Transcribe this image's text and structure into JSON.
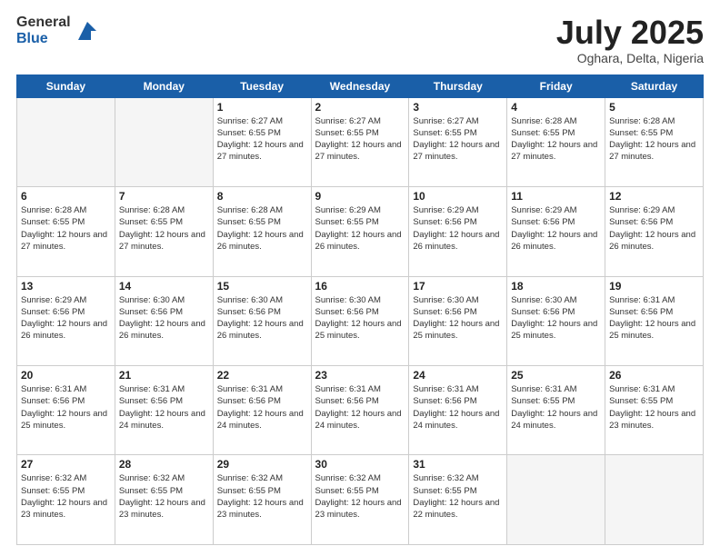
{
  "header": {
    "logo_general": "General",
    "logo_blue": "Blue",
    "month_title": "July 2025",
    "location": "Oghara, Delta, Nigeria"
  },
  "days_of_week": [
    "Sunday",
    "Monday",
    "Tuesday",
    "Wednesday",
    "Thursday",
    "Friday",
    "Saturday"
  ],
  "weeks": [
    [
      {
        "day": "",
        "info": ""
      },
      {
        "day": "",
        "info": ""
      },
      {
        "day": "1",
        "info": "Sunrise: 6:27 AM\nSunset: 6:55 PM\nDaylight: 12 hours and 27 minutes."
      },
      {
        "day": "2",
        "info": "Sunrise: 6:27 AM\nSunset: 6:55 PM\nDaylight: 12 hours and 27 minutes."
      },
      {
        "day": "3",
        "info": "Sunrise: 6:27 AM\nSunset: 6:55 PM\nDaylight: 12 hours and 27 minutes."
      },
      {
        "day": "4",
        "info": "Sunrise: 6:28 AM\nSunset: 6:55 PM\nDaylight: 12 hours and 27 minutes."
      },
      {
        "day": "5",
        "info": "Sunrise: 6:28 AM\nSunset: 6:55 PM\nDaylight: 12 hours and 27 minutes."
      }
    ],
    [
      {
        "day": "6",
        "info": "Sunrise: 6:28 AM\nSunset: 6:55 PM\nDaylight: 12 hours and 27 minutes."
      },
      {
        "day": "7",
        "info": "Sunrise: 6:28 AM\nSunset: 6:55 PM\nDaylight: 12 hours and 27 minutes."
      },
      {
        "day": "8",
        "info": "Sunrise: 6:28 AM\nSunset: 6:55 PM\nDaylight: 12 hours and 26 minutes."
      },
      {
        "day": "9",
        "info": "Sunrise: 6:29 AM\nSunset: 6:55 PM\nDaylight: 12 hours and 26 minutes."
      },
      {
        "day": "10",
        "info": "Sunrise: 6:29 AM\nSunset: 6:56 PM\nDaylight: 12 hours and 26 minutes."
      },
      {
        "day": "11",
        "info": "Sunrise: 6:29 AM\nSunset: 6:56 PM\nDaylight: 12 hours and 26 minutes."
      },
      {
        "day": "12",
        "info": "Sunrise: 6:29 AM\nSunset: 6:56 PM\nDaylight: 12 hours and 26 minutes."
      }
    ],
    [
      {
        "day": "13",
        "info": "Sunrise: 6:29 AM\nSunset: 6:56 PM\nDaylight: 12 hours and 26 minutes."
      },
      {
        "day": "14",
        "info": "Sunrise: 6:30 AM\nSunset: 6:56 PM\nDaylight: 12 hours and 26 minutes."
      },
      {
        "day": "15",
        "info": "Sunrise: 6:30 AM\nSunset: 6:56 PM\nDaylight: 12 hours and 26 minutes."
      },
      {
        "day": "16",
        "info": "Sunrise: 6:30 AM\nSunset: 6:56 PM\nDaylight: 12 hours and 25 minutes."
      },
      {
        "day": "17",
        "info": "Sunrise: 6:30 AM\nSunset: 6:56 PM\nDaylight: 12 hours and 25 minutes."
      },
      {
        "day": "18",
        "info": "Sunrise: 6:30 AM\nSunset: 6:56 PM\nDaylight: 12 hours and 25 minutes."
      },
      {
        "day": "19",
        "info": "Sunrise: 6:31 AM\nSunset: 6:56 PM\nDaylight: 12 hours and 25 minutes."
      }
    ],
    [
      {
        "day": "20",
        "info": "Sunrise: 6:31 AM\nSunset: 6:56 PM\nDaylight: 12 hours and 25 minutes."
      },
      {
        "day": "21",
        "info": "Sunrise: 6:31 AM\nSunset: 6:56 PM\nDaylight: 12 hours and 24 minutes."
      },
      {
        "day": "22",
        "info": "Sunrise: 6:31 AM\nSunset: 6:56 PM\nDaylight: 12 hours and 24 minutes."
      },
      {
        "day": "23",
        "info": "Sunrise: 6:31 AM\nSunset: 6:56 PM\nDaylight: 12 hours and 24 minutes."
      },
      {
        "day": "24",
        "info": "Sunrise: 6:31 AM\nSunset: 6:56 PM\nDaylight: 12 hours and 24 minutes."
      },
      {
        "day": "25",
        "info": "Sunrise: 6:31 AM\nSunset: 6:55 PM\nDaylight: 12 hours and 24 minutes."
      },
      {
        "day": "26",
        "info": "Sunrise: 6:31 AM\nSunset: 6:55 PM\nDaylight: 12 hours and 23 minutes."
      }
    ],
    [
      {
        "day": "27",
        "info": "Sunrise: 6:32 AM\nSunset: 6:55 PM\nDaylight: 12 hours and 23 minutes."
      },
      {
        "day": "28",
        "info": "Sunrise: 6:32 AM\nSunset: 6:55 PM\nDaylight: 12 hours and 23 minutes."
      },
      {
        "day": "29",
        "info": "Sunrise: 6:32 AM\nSunset: 6:55 PM\nDaylight: 12 hours and 23 minutes."
      },
      {
        "day": "30",
        "info": "Sunrise: 6:32 AM\nSunset: 6:55 PM\nDaylight: 12 hours and 23 minutes."
      },
      {
        "day": "31",
        "info": "Sunrise: 6:32 AM\nSunset: 6:55 PM\nDaylight: 12 hours and 22 minutes."
      },
      {
        "day": "",
        "info": ""
      },
      {
        "day": "",
        "info": ""
      }
    ]
  ]
}
